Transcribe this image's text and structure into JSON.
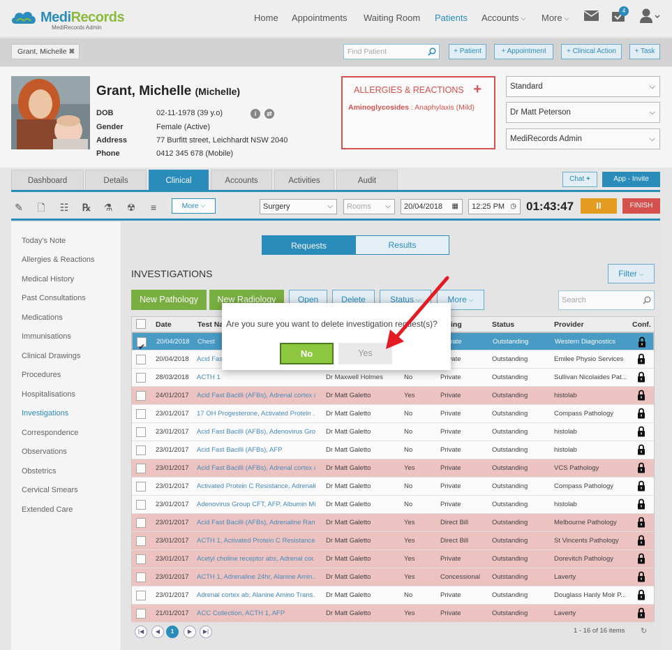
{
  "brand": {
    "name_part1": "Medi",
    "name_part2": "Records",
    "subtitle": "MediRecords Admin"
  },
  "nav": {
    "items": [
      {
        "label": "Home"
      },
      {
        "label": "Appointments"
      },
      {
        "label": "Waiting Room"
      },
      {
        "label": "Patients",
        "active": true
      },
      {
        "label": "Accounts",
        "dropdown": true
      },
      {
        "label": "More",
        "dropdown": true
      }
    ],
    "notification_count": "4",
    "icons": [
      "mail-icon",
      "inbox-icon",
      "user-icon"
    ]
  },
  "quickbar": {
    "patient_tag": "Grant, Michelle",
    "find_placeholder": "Find Patient",
    "buttons": [
      "+ Patient",
      "+ Appointment",
      "+ Clinical Action",
      "+ Task"
    ]
  },
  "patient": {
    "surname_name": "Grant, Michelle",
    "preferred": "(Michelle)",
    "fields": [
      {
        "label": "DOB",
        "value": "02-11-1978 (39 y.o)"
      },
      {
        "label": "Gender",
        "value": "Female (Active)"
      },
      {
        "label": "Address",
        "value": "77 Burfitt street, Leichhardt NSW 2040"
      },
      {
        "label": "Phone",
        "value": "0412 345 678 (Mobile)"
      }
    ]
  },
  "allergies": {
    "title": "ALLERGIES & REACTIONS",
    "add": "+",
    "item_name": "Aminoglycosides",
    "item_reaction": " : Anaphylaxis (Mild)"
  },
  "selectors": [
    "Standard",
    "Dr Matt Peterson",
    "MediRecords Admin"
  ],
  "tabs": [
    {
      "label": "Dashboard"
    },
    {
      "label": "Details"
    },
    {
      "label": "Clinical",
      "active": true
    },
    {
      "label": "Accounts"
    },
    {
      "label": "Activities"
    },
    {
      "label": "Audit"
    }
  ],
  "tab_actions": {
    "chat": "Chat",
    "app_invite": "App - Invite"
  },
  "toolbar": {
    "more": "More",
    "location": "Surgery",
    "rooms": "Rooms",
    "date": "20/04/2018",
    "time": "12:25 PM",
    "timer": "01:43:47",
    "pause": "II",
    "finish": "FINISH"
  },
  "sidebar": {
    "items": [
      {
        "label": "Today's Note"
      },
      {
        "label": "Allergies & Reactions"
      },
      {
        "label": "Medical History"
      },
      {
        "label": "Past Consultations"
      },
      {
        "label": "Medications"
      },
      {
        "label": "Immunisations"
      },
      {
        "label": "Clinical Drawings"
      },
      {
        "label": "Procedures"
      },
      {
        "label": "Hospitalisations"
      },
      {
        "label": "Investigations",
        "active": true
      },
      {
        "label": "Correspondence"
      },
      {
        "label": "Observations"
      },
      {
        "label": "Obstetrics"
      },
      {
        "label": "Cervical Smears"
      },
      {
        "label": "Extended Care"
      }
    ]
  },
  "investigations": {
    "tab_requests": "Requests",
    "tab_results": "Results",
    "title": "INVESTIGATIONS",
    "filter": "Filter",
    "buttons": [
      "New Pathology",
      "New Radiology",
      "Open",
      "Delete",
      "Status",
      "More"
    ],
    "search_placeholder": "Search",
    "columns": [
      "Date",
      "Test Na",
      "ing",
      "Status",
      "Provider",
      "Conf."
    ],
    "rows": [
      {
        "date": "20/04/2018",
        "test": "Chest",
        "doctor": "",
        "urgent": "",
        "billing": "Private",
        "status": "Outstanding",
        "provider": "Western Diagnostics",
        "style": "sel",
        "checked": true
      },
      {
        "date": "20/04/2018",
        "test": "Acid Fast",
        "doctor": "",
        "urgent": "",
        "billing": "Private",
        "status": "Outstanding",
        "provider": "Emilee Physio Services",
        "style": "white"
      },
      {
        "date": "28/03/2018",
        "test": "ACTH 1",
        "doctor": "Dr Maxwell Holmes",
        "urgent": "No",
        "billing": "Private",
        "status": "Outstanding",
        "provider": "Sullivan Nicolaides Pat...",
        "style": "white"
      },
      {
        "date": "24/01/2017",
        "test": "Acid Fast Bacilli (AFBs), Adrenal cortex a...",
        "doctor": "Dr Matt Galetto",
        "urgent": "Yes",
        "billing": "Private",
        "status": "Outstanding",
        "provider": "histolab",
        "style": "red"
      },
      {
        "date": "23/01/2017",
        "test": "17 OH Progesterone, Activated Protein ...",
        "doctor": "Dr Matt Galetto",
        "urgent": "No",
        "billing": "Private",
        "status": "Outstanding",
        "provider": "Compass Pathology",
        "style": "white"
      },
      {
        "date": "23/01/2017",
        "test": "Acid Fast Bacilli (AFBs), Adenovirus Grou...",
        "doctor": "Dr Matt Galetto",
        "urgent": "No",
        "billing": "Private",
        "status": "Outstanding",
        "provider": "histolab",
        "style": "white"
      },
      {
        "date": "23/01/2017",
        "test": "Acid Fast Bacilli (AFBs), AFP",
        "doctor": "Dr Matt Galetto",
        "urgent": "No",
        "billing": "Private",
        "status": "Outstanding",
        "provider": "histolab",
        "style": "white"
      },
      {
        "date": "23/01/2017",
        "test": "Acid Fast Bacilli (AFBs), Adrenal cortex a...",
        "doctor": "Dr Matt Galetto",
        "urgent": "Yes",
        "billing": "Private",
        "status": "Outstanding",
        "provider": "VCS Pathology",
        "style": "red"
      },
      {
        "date": "23/01/2017",
        "test": "Activated Protein C Resistance, Adrenali...",
        "doctor": "Dr Matt Galetto",
        "urgent": "No",
        "billing": "Private",
        "status": "Outstanding",
        "provider": "Compass Pathology",
        "style": "white"
      },
      {
        "date": "23/01/2017",
        "test": "Adenovirus Group CFT, AFP, Albumin Mi...",
        "doctor": "Dr Matt Galetto",
        "urgent": "No",
        "billing": "Private",
        "status": "Outstanding",
        "provider": "histolab",
        "style": "white"
      },
      {
        "date": "23/01/2017",
        "test": "Acid Fast Bacilli (AFBs), Adrenaline Rand...",
        "doctor": "Dr Matt Galetto",
        "urgent": "Yes",
        "billing": "Direct Bill",
        "status": "Outstanding",
        "provider": "Melbourne Pathology",
        "style": "red"
      },
      {
        "date": "23/01/2017",
        "test": "ACTH 1, Activated Protein C Resistance, ...",
        "doctor": "Dr Matt Galetto",
        "urgent": "Yes",
        "billing": "Direct Bill",
        "status": "Outstanding",
        "provider": "St Vincents Pathology",
        "style": "red"
      },
      {
        "date": "23/01/2017",
        "test": "Acetyl choline receptor abs, Adrenal cor...",
        "doctor": "Dr Matt Galetto",
        "urgent": "Yes",
        "billing": "Private",
        "status": "Outstanding",
        "provider": "Dorevitch Pathology",
        "style": "red"
      },
      {
        "date": "23/01/2017",
        "test": "ACTH 1, Adrenaline 24hr, Alanine Amin...",
        "doctor": "Dr Matt Galetto",
        "urgent": "Yes",
        "billing": "Concessional",
        "status": "Outstanding",
        "provider": "Laverty",
        "style": "red"
      },
      {
        "date": "23/01/2017",
        "test": "Adrenal cortex ab, Alanine Amino Trans...",
        "doctor": "Dr Matt Galetto",
        "urgent": "No",
        "billing": "Private",
        "status": "Outstanding",
        "provider": "Douglass Hanly Moir P...",
        "style": "white"
      },
      {
        "date": "21/01/2017",
        "test": "ACC Collection, ACTH 1, AFP",
        "doctor": "Dr Matt Galetto",
        "urgent": "Yes",
        "billing": "Private",
        "status": "Outstanding",
        "provider": "Laverty",
        "style": "red"
      }
    ],
    "pagination": {
      "current_page": "1",
      "first": "|◀",
      "prev": "◀",
      "next": "▶",
      "last": "▶|",
      "summary": "1 - 16 of 16 items"
    }
  },
  "dialog": {
    "message": "Are you sure you want to delete investigation request(s)?",
    "no": "No",
    "yes": "Yes"
  },
  "colors": {
    "primary": "#2b8fbf",
    "green": "#7cb342",
    "alert": "#d9534f",
    "row_urgent": "#f2c7c6",
    "annotation_arrow": "#e31b23"
  }
}
